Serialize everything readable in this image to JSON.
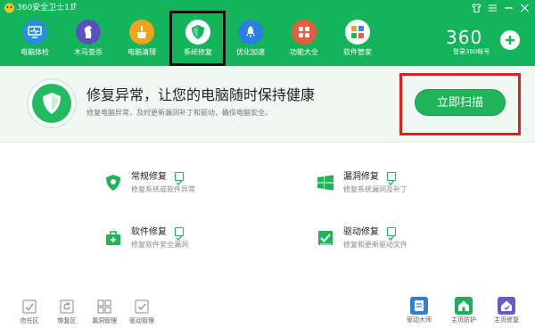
{
  "app": {
    "title": "360安全卫士11",
    "title_suffix": "↑"
  },
  "nav": {
    "items": [
      {
        "label": "电脑体检",
        "icon": "monitor-check-icon"
      },
      {
        "label": "木马查杀",
        "icon": "horse-icon"
      },
      {
        "label": "电脑清理",
        "icon": "broom-icon"
      },
      {
        "label": "系统修复",
        "icon": "shield-icon",
        "active": true
      },
      {
        "label": "优化加速",
        "icon": "rocket-icon"
      },
      {
        "label": "功能大全",
        "icon": "grid-icon"
      },
      {
        "label": "软件管家",
        "icon": "app-store-icon"
      }
    ]
  },
  "brand": {
    "logo_text": "360",
    "login_text": "登录360帐号"
  },
  "banner": {
    "title": "修复异常，让您的电脑随时保持健康",
    "description": "修复电脑异常，及时更新漏洞补丁和驱动，确保电脑安全。",
    "scan_button": "立即扫描"
  },
  "repairs": [
    {
      "title": "常规修复",
      "desc": "修复系统或软件异常",
      "icon": "shield-icon",
      "checked": true
    },
    {
      "title": "漏洞修复",
      "desc": "修复系统漏洞及补丁",
      "icon": "windows-icon",
      "checked": true
    },
    {
      "title": "软件修复",
      "desc": "修复软件安全漏洞",
      "icon": "toolbox-icon",
      "checked": true
    },
    {
      "title": "驱动修复",
      "desc": "修复和更新驱动文件",
      "icon": "driver-icon",
      "checked": true
    }
  ],
  "bottom_tools": [
    {
      "label": "信任区",
      "icon": "trust-zone-icon"
    },
    {
      "label": "恢复区",
      "icon": "restore-icon"
    },
    {
      "label": "漏洞管理",
      "icon": "patch-manage-icon"
    },
    {
      "label": "驱动管理",
      "icon": "driver-manage-icon"
    }
  ],
  "right_tools": [
    {
      "label": "驱动大师",
      "icon": "driver-master-icon",
      "color": "#2f7fd8"
    },
    {
      "label": "主页防护",
      "icon": "homepage-protect-icon",
      "color": "#1fae55"
    },
    {
      "label": "主页修复",
      "icon": "homepage-repair-icon",
      "color": "#6a5ac8"
    }
  ],
  "colors": {
    "header": "#13b45a",
    "accent": "#1fb45a",
    "banner_bg": "#f1f8f4",
    "highlight_red": "#e02020"
  }
}
